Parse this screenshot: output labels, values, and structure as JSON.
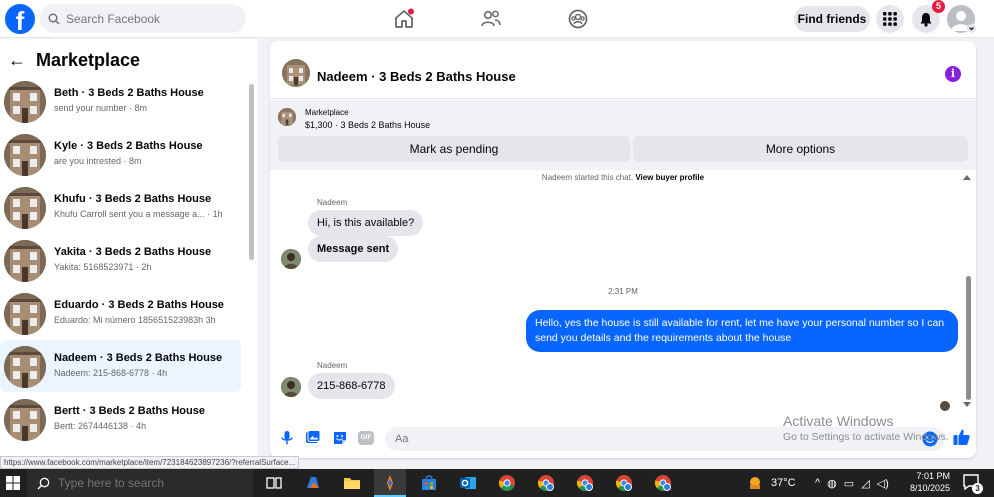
{
  "header": {
    "search_placeholder": "Search Facebook",
    "find_friends_label": "Find friends",
    "notification_count": "5",
    "logo_letter": "f"
  },
  "sidebar": {
    "title": "Marketplace",
    "conversations": [
      {
        "name": "Beth · 3 Beds 2 Baths House",
        "snippet": "send your number · 8m",
        "active": false
      },
      {
        "name": "Kyle · 3 Beds 2 Baths House",
        "snippet": "are you intrested · 8m",
        "active": false
      },
      {
        "name": "Khufu · 3 Beds 2 Baths House",
        "snippet": "Khufu Carroll sent you a message a... · 1h",
        "active": false
      },
      {
        "name": "Yakita · 3 Beds 2 Baths House",
        "snippet": "Yakita: 5168523971 · 2h",
        "active": false
      },
      {
        "name": "Eduardo · 3 Beds 2 Baths House",
        "snippet": "Eduardo: Mi número 185651523983h 3h",
        "active": false
      },
      {
        "name": "Nadeem · 3 Beds 2 Baths House",
        "snippet": "Nadeem: 215-868-6778 · 4h",
        "active": true
      },
      {
        "name": "Bertt · 3 Beds 2 Baths House",
        "snippet": "Bertt: 2674446138 · 4h",
        "active": false
      }
    ]
  },
  "chat": {
    "title": "Nadeem · 3 Beds 2 Baths House",
    "listing_source": "Marketplace",
    "listing_price": "$1,300 · 3 Beds 2 Baths House",
    "mark_pending_label": "Mark as pending",
    "more_options_label": "More options",
    "system_line": "Nadeem started this chat.",
    "system_link": "View buyer profile",
    "sender_name": "Nadeem",
    "msg1": "Hi, is this available?",
    "msg2": "Message sent",
    "timestamp": "2:31 PM",
    "msg_out": "Hello, yes the house is still available for rent, let me have your personal number so I can send you details and the requirements about the house",
    "sender_name2": "Nadeem",
    "msg3": "215-868-6778",
    "composer_placeholder": "Aa",
    "gif_label": "GIF"
  },
  "watermark": {
    "line1": "Activate Windows",
    "line2": "Go to Settings to activate Windows."
  },
  "status_url": "https://www.facebook.com/marketplace/item/723184623897236/?referralSurface...",
  "taskbar": {
    "search_placeholder": "Type here to search",
    "temperature": "37°C",
    "time": "7:01 PM",
    "date": "8/10/2025",
    "notification_count": "3"
  },
  "colors": {
    "brand_blue": "#0866ff",
    "badge_red": "#e41e3f",
    "info_purple": "#8b20d8"
  }
}
